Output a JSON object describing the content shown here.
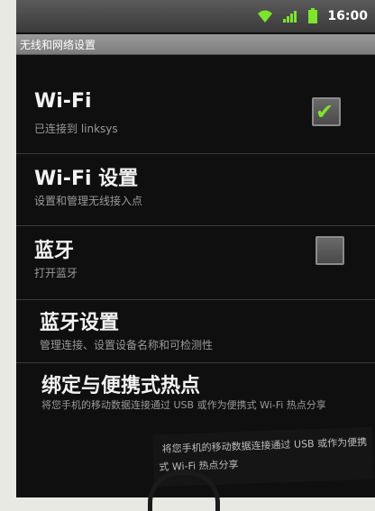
{
  "status_bar": {
    "time": "16:00",
    "icons": [
      "wifi-icon",
      "signal-icon",
      "battery-icon"
    ],
    "accent_color": "#7de52c"
  },
  "title_bar": {
    "title": "无线和网络设置"
  },
  "settings": [
    {
      "title": "Wi-Fi",
      "subtitle": "已连接到 linksys",
      "checkbox": true,
      "checked": true
    },
    {
      "title": "Wi-Fi 设置",
      "subtitle": "设置和管理无线接入点"
    },
    {
      "title": "蓝牙",
      "subtitle": "打开蓝牙",
      "checkbox": true,
      "checked": false
    },
    {
      "title": "蓝牙设置",
      "subtitle": "管理连接、设置设备名称和可检测性"
    },
    {
      "title": "绑定与便携式热点",
      "subtitle": "将您手机的移动数据连接通过 USB 或作为便携式 Wi-Fi 热点分享"
    }
  ],
  "overlay_scrap": {
    "line1": "将您手机的移动数据连接通过 USB 或作为便携",
    "line2": "式 Wi-Fi 热点分享"
  }
}
